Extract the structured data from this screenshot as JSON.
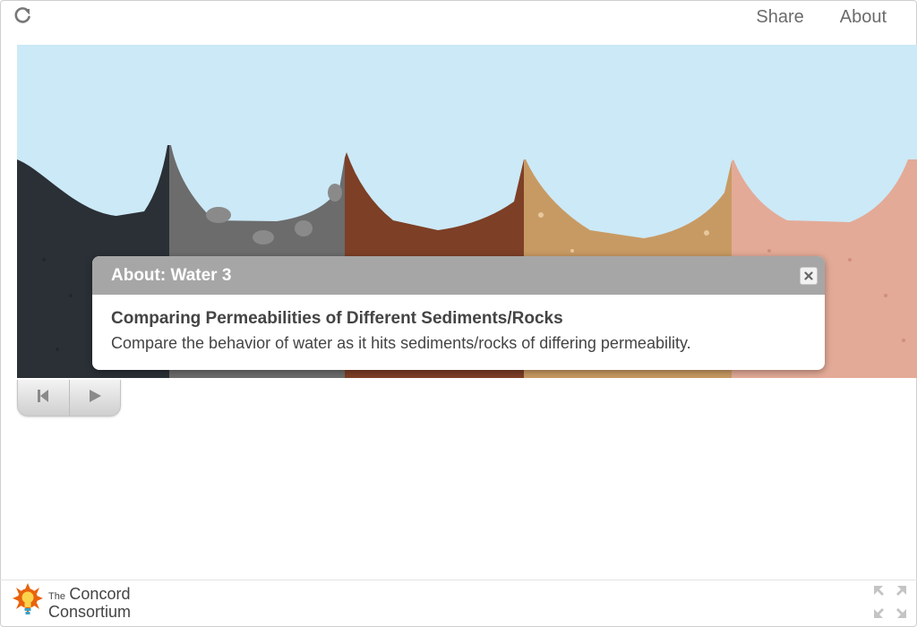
{
  "nav": {
    "share": "Share",
    "about": "About"
  },
  "icons": {
    "reload": "reload-icon",
    "reset": "skip-back-icon",
    "play": "play-icon",
    "close": "close-icon",
    "fullscreen": "fullscreen-icon",
    "logo": "sun-bulb-logo-icon"
  },
  "dialog": {
    "title": "About: Water 3",
    "heading": "Comparing Permeabilities of Different Sediments/Rocks",
    "text": "Compare the behavior of water as it hits sediments/rocks of differing permeability."
  },
  "footer": {
    "logo_line1": "The",
    "logo_line2": "Concord",
    "logo_line3": "Consortium"
  },
  "colors": {
    "sky": "#cce9f7",
    "sediments": [
      "#2a3036",
      "#6c6c6c",
      "#7d3f26",
      "#c89a63",
      "#e3aa97"
    ],
    "dialog_header": "#a6a6a6",
    "logo_orange": "#e8620c"
  }
}
